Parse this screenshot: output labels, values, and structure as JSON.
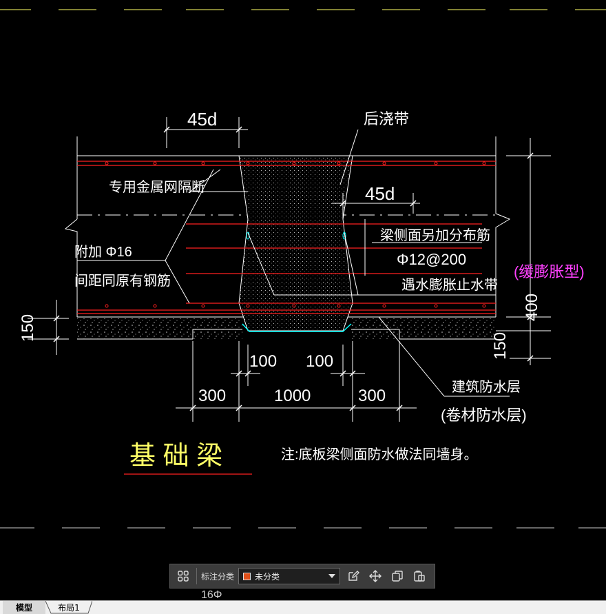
{
  "drawing": {
    "dim_45d_top": "45d",
    "label_post_cast_strip": "后浇带",
    "label_metal_mesh": "专用金属网隔断",
    "dim_45d_mid": "45d",
    "label_side_rebar": "梁侧面另加分布筋",
    "label_rebar_spec": "Φ12@200",
    "label_waterstop": "遇水膨胀止水带",
    "label_swelling_type": "(缓膨胀型)",
    "label_extra_rebar": "附加 Φ16",
    "label_spacing": "间距同原有钢筋",
    "dim_150_left": "150",
    "dim_400_right": "400",
    "dim_150_right": "150",
    "dim_100_left": "100",
    "dim_100_right": "100",
    "dim_300_left": "300",
    "dim_1000": "1000",
    "dim_300_right": "300",
    "label_waterproof": "建筑防水层",
    "label_membrane": "(卷材防水层)",
    "title": "基 础 梁",
    "note": "注:底板梁侧面防水做法同墙身。",
    "partial_text_bottom": "16Φ"
  },
  "toolbar": {
    "grid_icon": "grid-icon",
    "annotation_class_label": "标注分类",
    "select_value": "未分类",
    "select_swatch_color": "#e0501a",
    "edit_icon": "edit-icon",
    "move_icon": "move-icon",
    "copy_icon": "copy-icon",
    "paste_icon": "paste-icon"
  },
  "tabs": {
    "model": "模型",
    "layout1": "布局1"
  },
  "colors": {
    "background": "#000000",
    "rebar": "#ff2020",
    "dimension": "#ffffff",
    "title": "#ffff66",
    "swelling": "#ff40ff",
    "waterstop": "#00ffff",
    "underline": "#ff2020",
    "dash_yellow": "#ffff66"
  }
}
